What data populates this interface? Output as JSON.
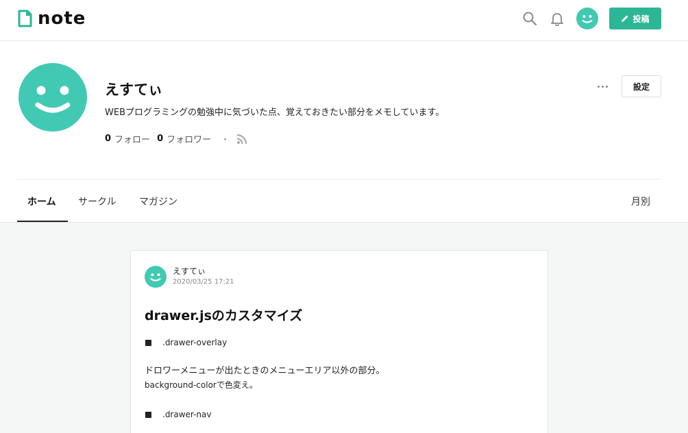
{
  "header": {
    "logo_text": "note",
    "post_button_label": "投稿",
    "accent_color": "#2cb696",
    "icons": [
      "note-logo-icon",
      "search-icon",
      "bell-icon",
      "user-avatar-icon",
      "pencil-icon"
    ]
  },
  "profile": {
    "name": "えすてぃ",
    "bio": "WEBプログラミングの勉強中に気づいた点、覚えておきたい部分をメモしています。",
    "follow_count": "0",
    "follow_label": "フォロー",
    "follower_count": "0",
    "follower_label": "フォロワー",
    "separator": "・",
    "settings_label": "設定",
    "avatar_color": "#41c9b4"
  },
  "tabs": {
    "items": [
      {
        "label": "ホーム"
      },
      {
        "label": "サークル"
      },
      {
        "label": "マガジン"
      }
    ],
    "active": "ホーム",
    "monthly_label": "月別"
  },
  "card": {
    "author": "えすてぃ",
    "date": "2020/03/25 17:21",
    "title": "drawer.jsのカスタマイズ",
    "item1": ".drawer-overlay",
    "para_line1": "ドロワーメニューが出たときのメニューエリア以外の部分。",
    "para_line2": "background-colorで色変え。",
    "item2": ".drawer-nav"
  }
}
